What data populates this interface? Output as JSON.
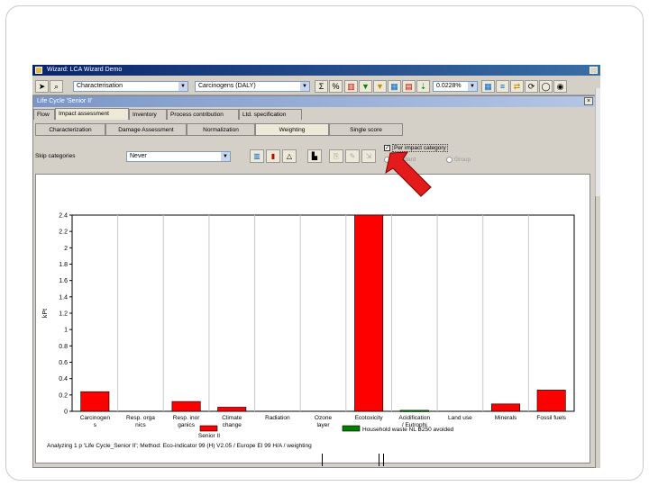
{
  "app": {
    "title": "Wizard: LCA Wizard Demo",
    "toolbar": {
      "method_combo": "Characterisation",
      "category_combo": "Carcinogens (DALY)",
      "cutoff_value": "0.0228%",
      "sum_symbol": "Σ",
      "percent_symbol": "%"
    }
  },
  "subwindow": {
    "title": "Life Cycle 'Senior II'",
    "close_label": "×",
    "top_tabs": [
      "Flow",
      "Impact assessment",
      "Inventory",
      "Process contribution",
      "Ltd. specification"
    ],
    "active_top_tab": 1,
    "sub_tabs": [
      "Characterization",
      "Damage Assessment",
      "Normalization",
      "Weighting",
      "Single score"
    ],
    "active_sub_tab": 3,
    "skip_label": "Skip categories",
    "skip_value": "Never",
    "per_impact_label": "Per impact category",
    "per_impact_checked": "✓",
    "radio_standard": "Standard",
    "radio_group": "Group"
  },
  "chart_data": {
    "type": "bar",
    "ylabel": "kPt",
    "ylim": [
      0,
      2.4
    ],
    "yticks": [
      "0",
      "0.2",
      "0.4",
      "0.6",
      "0.8",
      "1",
      "1.2",
      "1.4",
      "1.6",
      "1.8",
      "2",
      "2.2",
      "2.4"
    ],
    "categories": [
      [
        "Carcinogen",
        "s"
      ],
      [
        "Resp. orga",
        "nics"
      ],
      [
        "Resp. inor",
        "ganics"
      ],
      [
        "Climate",
        "change"
      ],
      [
        "Radiation",
        ""
      ],
      [
        "Ozone",
        "layer"
      ],
      [
        "Ecotoxicity",
        ""
      ],
      [
        "Acidification",
        "/ Eutrophi"
      ],
      [
        "Land use",
        ""
      ],
      [
        "Minerals",
        ""
      ],
      [
        "Fossil fuels",
        ""
      ]
    ],
    "series": [
      {
        "name": "Senior II",
        "color": "#ff0000",
        "values": [
          0.24,
          0.0,
          0.12,
          0.05,
          0.0,
          0.0,
          2.48,
          0.0,
          0.0,
          0.09,
          0.26
        ]
      },
      {
        "name": "Household waste NL B250 avoided",
        "color": "#008000",
        "values": [
          0.0,
          0.0,
          0.0,
          0.0,
          0.0,
          0.0,
          0.0,
          0.012,
          0.0,
          0.0,
          0.0
        ]
      }
    ],
    "caption": "Analyzing 1 p 'Life Cycle_Senior II'; Method: Eco-indicator 99 (H) V2.05 / Europe EI 99 H/A / weighting"
  }
}
